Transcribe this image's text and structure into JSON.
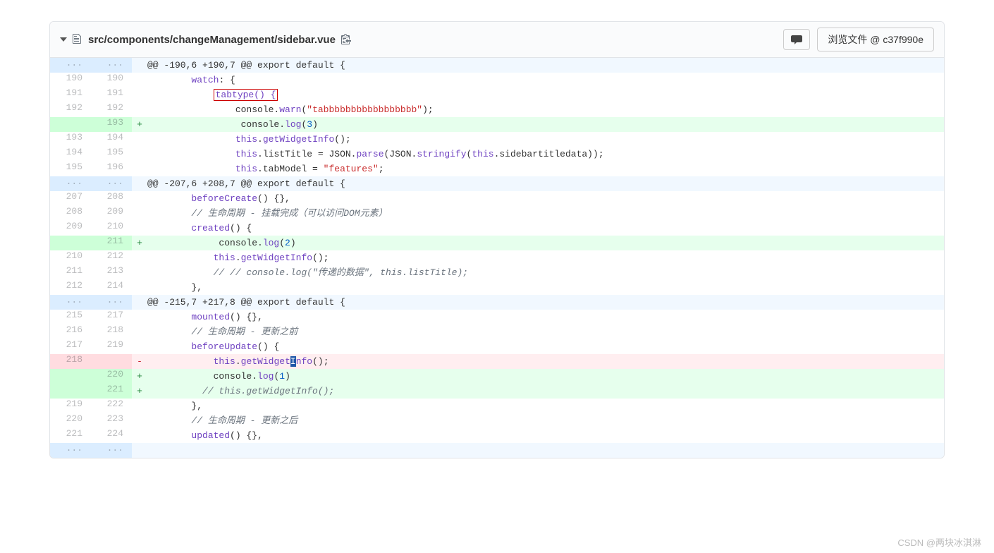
{
  "file": {
    "path": "src/components/changeManagement/sidebar.vue",
    "browse_label": "浏览文件 @ c37f990e"
  },
  "rows": [
    {
      "type": "hunk",
      "old": "...",
      "new": "...",
      "tokens": [
        {
          "t": "@@ -190,6 +190,7 @@ export default {",
          "c": "hunk"
        }
      ]
    },
    {
      "type": "ctx",
      "old": "190",
      "new": "190",
      "tokens": [
        {
          "t": "        ",
          "c": "plain"
        },
        {
          "t": "watch",
          "c": "fn"
        },
        {
          "t": ": {",
          "c": "plain"
        }
      ]
    },
    {
      "type": "ctx",
      "old": "191",
      "new": "191",
      "tokens": [
        {
          "t": "            ",
          "c": "plain"
        },
        {
          "t": "tabtype() {",
          "c": "fn",
          "redbox": true
        }
      ]
    },
    {
      "type": "ctx",
      "old": "192",
      "new": "192",
      "tokens": [
        {
          "t": "                console.",
          "c": "plain"
        },
        {
          "t": "warn",
          "c": "fn"
        },
        {
          "t": "(",
          "c": "plain"
        },
        {
          "t": "\"tabbbbbbbbbbbbbbbbb\"",
          "c": "str"
        },
        {
          "t": ");",
          "c": "plain"
        }
      ]
    },
    {
      "type": "add",
      "old": "",
      "new": "193",
      "tokens": [
        {
          "t": "                 console.",
          "c": "plain"
        },
        {
          "t": "log",
          "c": "fn"
        },
        {
          "t": "(",
          "c": "plain"
        },
        {
          "t": "3",
          "c": "num"
        },
        {
          "t": ")",
          "c": "plain"
        }
      ]
    },
    {
      "type": "ctx",
      "old": "193",
      "new": "194",
      "tokens": [
        {
          "t": "                ",
          "c": "plain"
        },
        {
          "t": "this",
          "c": "this"
        },
        {
          "t": ".",
          "c": "plain"
        },
        {
          "t": "getWidgetInfo",
          "c": "fn"
        },
        {
          "t": "();",
          "c": "plain"
        }
      ]
    },
    {
      "type": "ctx",
      "old": "194",
      "new": "195",
      "tokens": [
        {
          "t": "                ",
          "c": "plain"
        },
        {
          "t": "this",
          "c": "this"
        },
        {
          "t": ".listTitle = JSON.",
          "c": "plain"
        },
        {
          "t": "parse",
          "c": "fn"
        },
        {
          "t": "(JSON.",
          "c": "plain"
        },
        {
          "t": "stringify",
          "c": "fn"
        },
        {
          "t": "(",
          "c": "plain"
        },
        {
          "t": "this",
          "c": "this"
        },
        {
          "t": ".sidebartitledata));",
          "c": "plain"
        }
      ]
    },
    {
      "type": "ctx",
      "old": "195",
      "new": "196",
      "tokens": [
        {
          "t": "                ",
          "c": "plain"
        },
        {
          "t": "this",
          "c": "this"
        },
        {
          "t": ".tabModel = ",
          "c": "plain"
        },
        {
          "t": "\"features\"",
          "c": "str"
        },
        {
          "t": ";",
          "c": "plain"
        }
      ]
    },
    {
      "type": "hunk",
      "old": "...",
      "new": "...",
      "tokens": [
        {
          "t": "@@ -207,6 +208,7 @@ export default {",
          "c": "hunk"
        }
      ]
    },
    {
      "type": "ctx",
      "old": "207",
      "new": "208",
      "tokens": [
        {
          "t": "        ",
          "c": "plain"
        },
        {
          "t": "beforeCreate",
          "c": "fn"
        },
        {
          "t": "() {},",
          "c": "plain"
        }
      ]
    },
    {
      "type": "ctx",
      "old": "208",
      "new": "209",
      "tokens": [
        {
          "t": "        ",
          "c": "plain"
        },
        {
          "t": "// 生命周期 - 挂载完成（可以访问DOM元素）",
          "c": "comment"
        }
      ]
    },
    {
      "type": "ctx",
      "old": "209",
      "new": "210",
      "tokens": [
        {
          "t": "        ",
          "c": "plain"
        },
        {
          "t": "created",
          "c": "fn"
        },
        {
          "t": "() {",
          "c": "plain"
        }
      ]
    },
    {
      "type": "add",
      "old": "",
      "new": "211",
      "tokens": [
        {
          "t": "             console.",
          "c": "plain"
        },
        {
          "t": "log",
          "c": "fn"
        },
        {
          "t": "(",
          "c": "plain"
        },
        {
          "t": "2",
          "c": "num"
        },
        {
          "t": ")",
          "c": "plain"
        }
      ]
    },
    {
      "type": "ctx",
      "old": "210",
      "new": "212",
      "tokens": [
        {
          "t": "            ",
          "c": "plain"
        },
        {
          "t": "this",
          "c": "this"
        },
        {
          "t": ".",
          "c": "plain"
        },
        {
          "t": "getWidgetInfo",
          "c": "fn"
        },
        {
          "t": "();",
          "c": "plain"
        }
      ]
    },
    {
      "type": "ctx",
      "old": "211",
      "new": "213",
      "tokens": [
        {
          "t": "            ",
          "c": "plain"
        },
        {
          "t": "// // console.log(\"传递的数据\", this.listTitle);",
          "c": "comment"
        }
      ]
    },
    {
      "type": "ctx",
      "old": "212",
      "new": "214",
      "tokens": [
        {
          "t": "        },",
          "c": "plain"
        }
      ]
    },
    {
      "type": "hunk",
      "old": "...",
      "new": "...",
      "tokens": [
        {
          "t": "@@ -215,7 +217,8 @@ export default {",
          "c": "hunk"
        }
      ]
    },
    {
      "type": "ctx",
      "old": "215",
      "new": "217",
      "tokens": [
        {
          "t": "        ",
          "c": "plain"
        },
        {
          "t": "mounted",
          "c": "fn"
        },
        {
          "t": "() {},",
          "c": "plain"
        }
      ]
    },
    {
      "type": "ctx",
      "old": "216",
      "new": "218",
      "tokens": [
        {
          "t": "        ",
          "c": "plain"
        },
        {
          "t": "// 生命周期 - 更新之前",
          "c": "comment"
        }
      ]
    },
    {
      "type": "ctx",
      "old": "217",
      "new": "219",
      "tokens": [
        {
          "t": "        ",
          "c": "plain"
        },
        {
          "t": "beforeUpdate",
          "c": "fn"
        },
        {
          "t": "() {",
          "c": "plain"
        }
      ]
    },
    {
      "type": "del",
      "old": "218",
      "new": "",
      "tokens": [
        {
          "t": "            ",
          "c": "plain"
        },
        {
          "t": "this",
          "c": "this"
        },
        {
          "t": ".",
          "c": "plain"
        },
        {
          "t": "getWidget",
          "c": "fn"
        },
        {
          "t": "I",
          "c": "fn",
          "cursor": true
        },
        {
          "t": "nfo",
          "c": "fn"
        },
        {
          "t": "();",
          "c": "plain"
        }
      ]
    },
    {
      "type": "add",
      "old": "",
      "new": "220",
      "tokens": [
        {
          "t": "            console.",
          "c": "plain"
        },
        {
          "t": "log",
          "c": "fn"
        },
        {
          "t": "(",
          "c": "plain"
        },
        {
          "t": "1",
          "c": "num"
        },
        {
          "t": ")",
          "c": "plain"
        }
      ]
    },
    {
      "type": "add",
      "old": "",
      "new": "221",
      "tokens": [
        {
          "t": "          ",
          "c": "plain"
        },
        {
          "t": "// this.getWidgetInfo();",
          "c": "comment"
        }
      ]
    },
    {
      "type": "ctx",
      "old": "219",
      "new": "222",
      "tokens": [
        {
          "t": "        },",
          "c": "plain"
        }
      ]
    },
    {
      "type": "ctx",
      "old": "220",
      "new": "223",
      "tokens": [
        {
          "t": "        ",
          "c": "plain"
        },
        {
          "t": "// 生命周期 - 更新之后",
          "c": "comment"
        }
      ]
    },
    {
      "type": "ctx",
      "old": "221",
      "new": "224",
      "tokens": [
        {
          "t": "        ",
          "c": "plain"
        },
        {
          "t": "updated",
          "c": "fn"
        },
        {
          "t": "() {},",
          "c": "plain"
        }
      ]
    },
    {
      "type": "hunk",
      "old": "...",
      "new": "...",
      "tokens": [
        {
          "t": "",
          "c": "hunk"
        }
      ]
    }
  ],
  "watermark": "CSDN @两块冰淇淋"
}
